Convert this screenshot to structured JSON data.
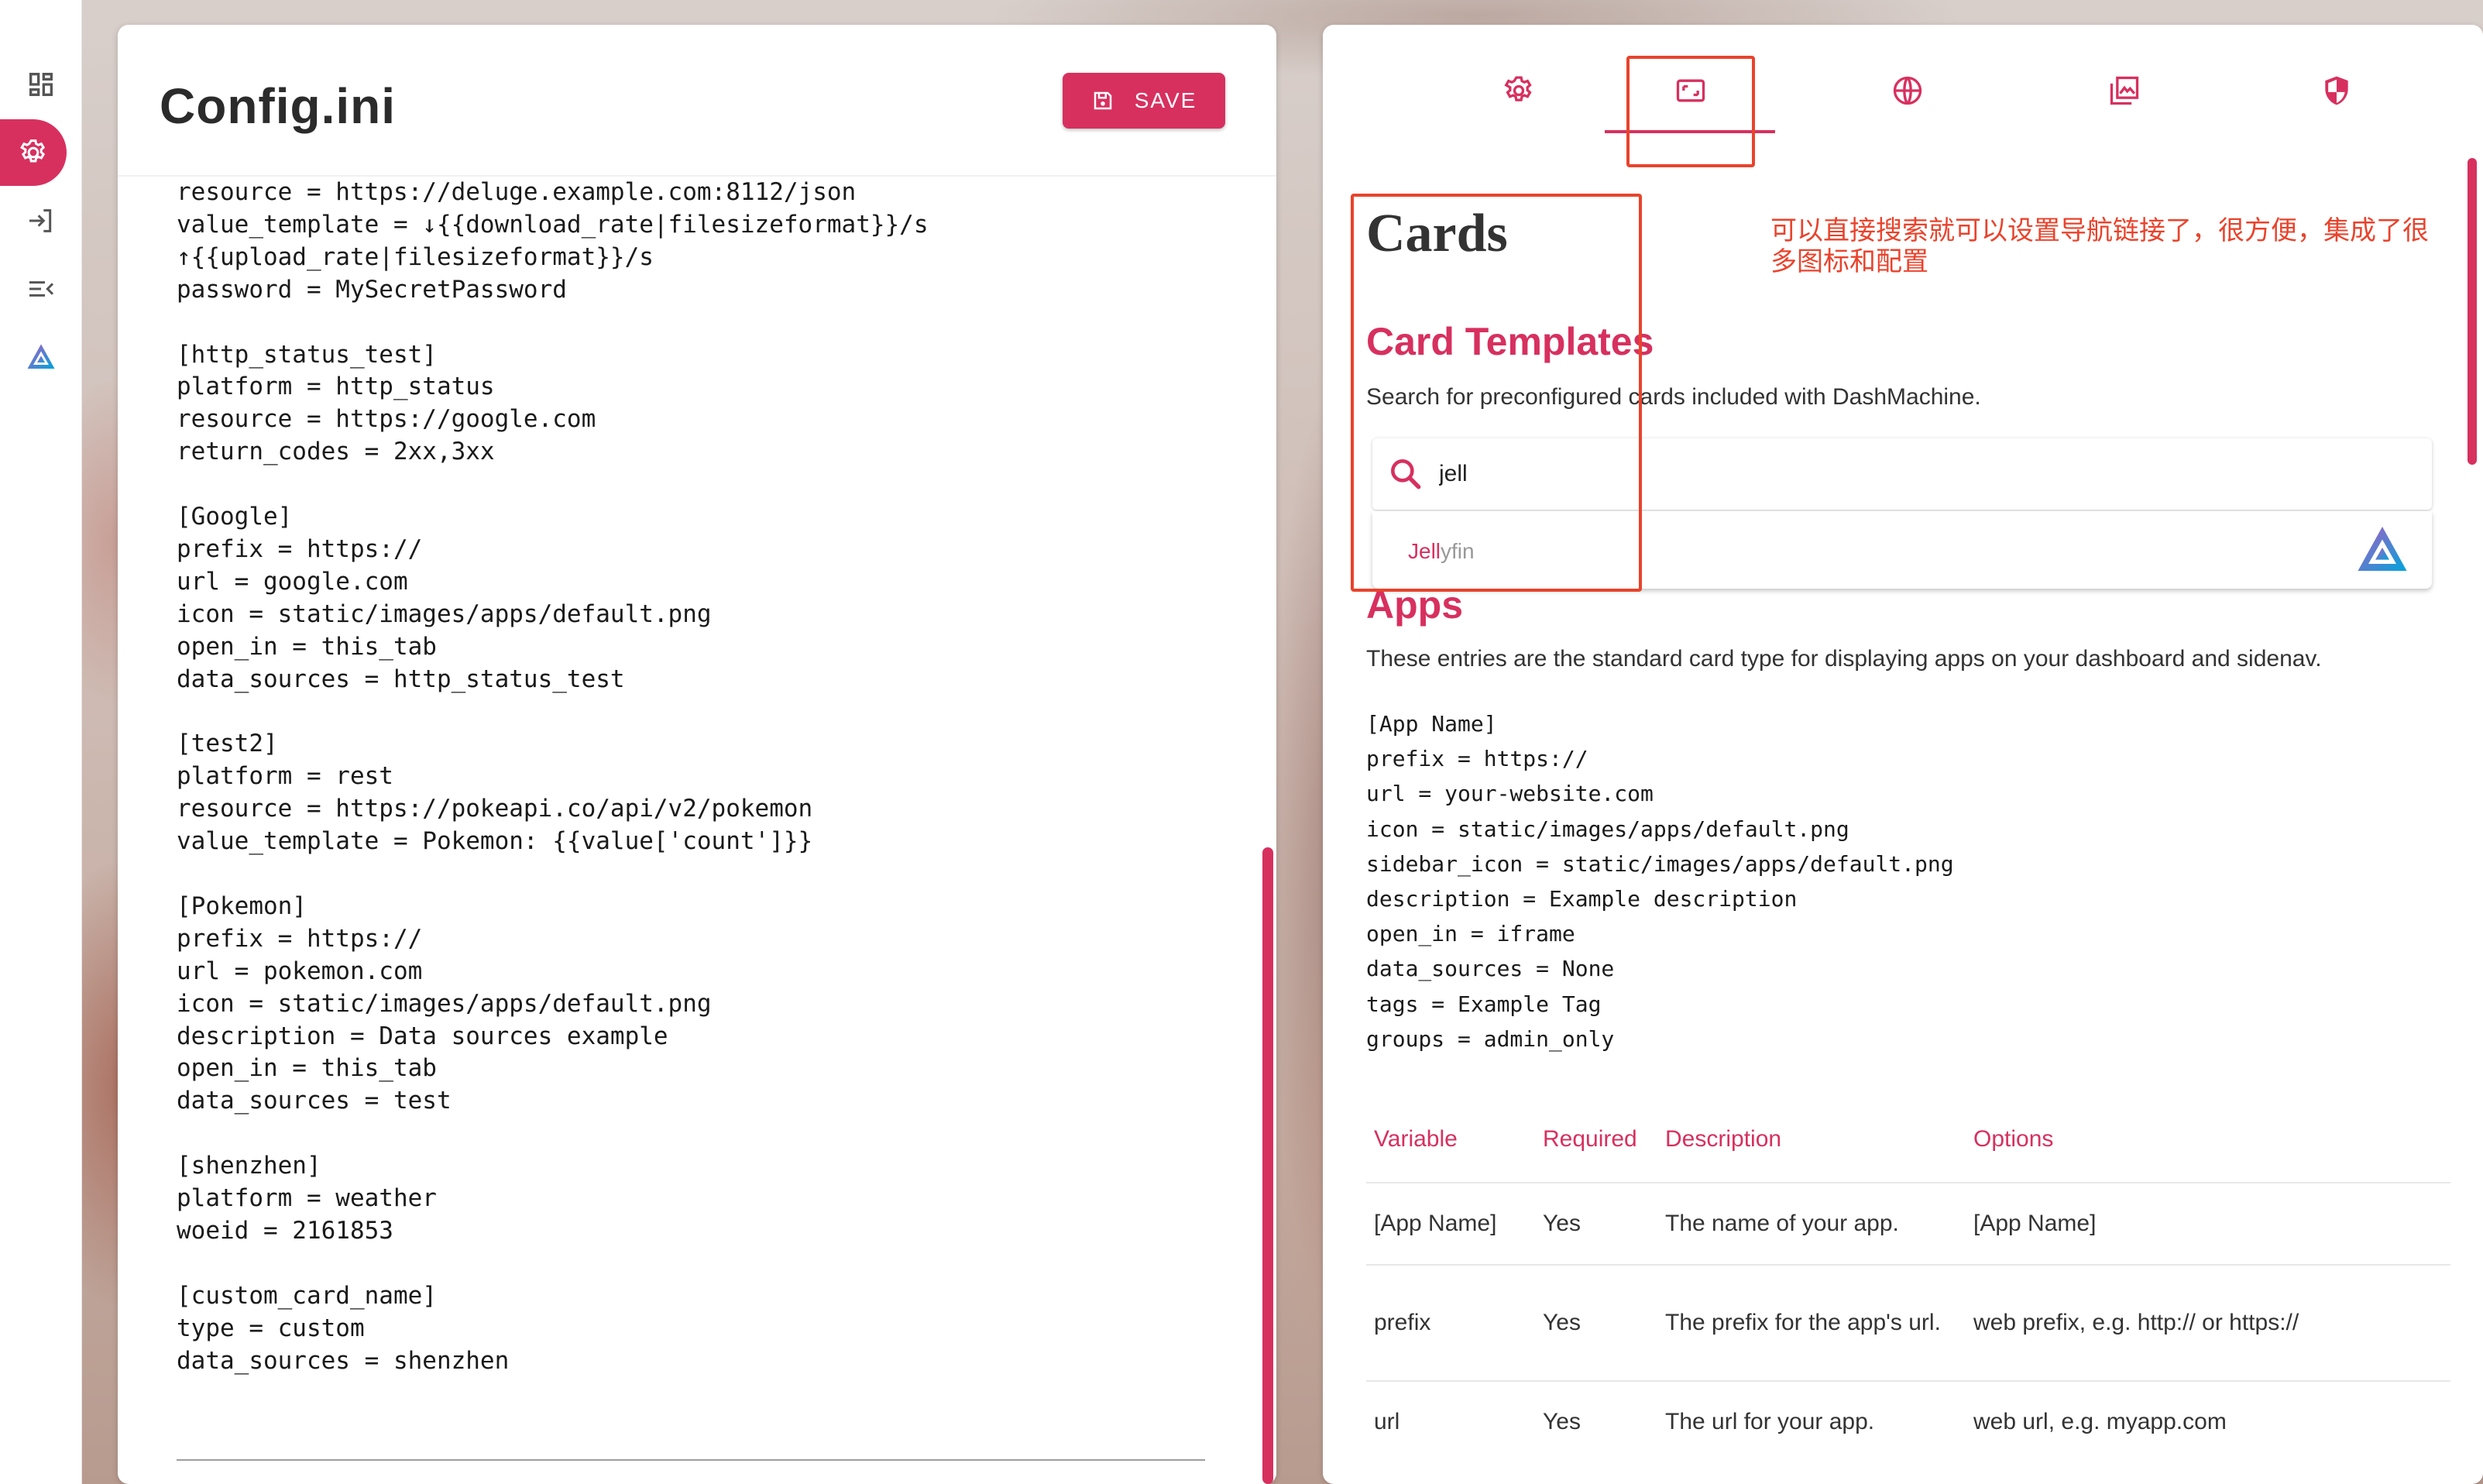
{
  "nav": {
    "items": [
      {
        "icon": "dashboard-icon"
      },
      {
        "icon": "settings-icon",
        "active": true
      },
      {
        "icon": "login-icon"
      },
      {
        "icon": "menu-collapse-icon"
      },
      {
        "icon": "jellyfin-icon"
      }
    ]
  },
  "editor": {
    "title": "Config.ini",
    "save_label": "SAVE",
    "content": "resource = https://deluge.example.com:8112/json\nvalue_template = ↓{{download_rate|filesizeformat}}/s\n↑{{upload_rate|filesizeformat}}/s\npassword = MySecretPassword\n\n[http_status_test]\nplatform = http_status\nresource = https://google.com\nreturn_codes = 2xx,3xx\n\n[Google]\nprefix = https://\nurl = google.com\nicon = static/images/apps/default.png\nopen_in = this_tab\ndata_sources = http_status_test\n\n[test2]\nplatform = rest\nresource = https://pokeapi.co/api/v2/pokemon\nvalue_template = Pokemon: {{value['count']}}\n\n[Pokemon]\nprefix = https://\nurl = pokemon.com\nicon = static/images/apps/default.png\ndescription = Data sources example\nopen_in = this_tab\ndata_sources = test\n\n[shenzhen]\nplatform = weather\nwoeid = 2161853\n\n[custom_card_name]\ntype = custom\ndata_sources = shenzhen"
  },
  "docs": {
    "tabs": [
      "settings-icon",
      "cards-icon",
      "globe-icon",
      "images-icon",
      "shield-icon"
    ],
    "active_tab": 1,
    "title": "Cards",
    "annotation": "可以直接搜索就可以设置导航链接了，很方便，集成了很多图标和配置",
    "card_templates": {
      "heading": "Card Templates",
      "description": "Search for preconfigured cards included with DashMachine.",
      "search_value": "jell",
      "suggestion_match": "Jell",
      "suggestion_rest": "yfin"
    },
    "apps": {
      "heading": "Apps",
      "description": "These entries are the standard card type for displaying apps on your dashboard and sidenav.",
      "sample": "[App Name]\nprefix = https://\nurl = your-website.com\nicon = static/images/apps/default.png\nsidebar_icon = static/images/apps/default.png\ndescription = Example description\nopen_in = iframe\ndata_sources = None\ntags = Example Tag\ngroups = admin_only",
      "table": {
        "headers": [
          "Variable",
          "Required",
          "Description",
          "Options"
        ],
        "rows": [
          [
            "[App Name]",
            "Yes",
            "The name of your app.",
            "[App Name]"
          ],
          [
            "prefix",
            "Yes",
            "The prefix for the app's url.",
            "web prefix, e.g. http:// or https://"
          ],
          [
            "url",
            "Yes",
            "The url for your app.",
            "web url, e.g. myapp.com"
          ]
        ]
      }
    }
  },
  "colors": {
    "accent": "#d7305f",
    "annotation": "#e9432c"
  }
}
